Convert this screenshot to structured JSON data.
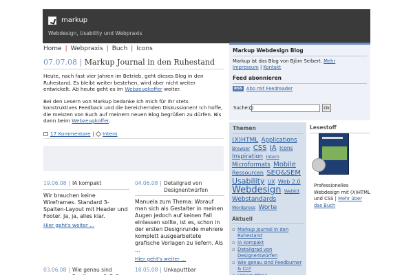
{
  "header": {
    "title": "markup",
    "tagline": "Webdesign, Usability und Webpraxis",
    "bg_color": "#3a3a3a"
  },
  "nav": {
    "items": [
      "Home",
      "Webpraxis",
      "Buch",
      "Icons"
    ]
  },
  "post": {
    "date": "07.07.08",
    "separator": "|",
    "title": "Markup Journal in den Ruhestand",
    "paragraph1": "Heute, nach fast vier Jahren im Betrieb, geht dieses Blog in den Ruhestand. Es bleibt weiter bestehen, wird aber nicht weiter entwickelt. Ab heute geht es im ",
    "paragraph1_link": "Webzeugkoffer",
    "paragraph1_end": " weiter.",
    "paragraph2": "Bei den Lesern von Markup bedanke ich mich für Ihr stets konstruktives Feedback und die bereichernden Diskussionen! Ich hoffe, die meisten von Euch auf meinem neuen Blog begrüßen zu dürfen. Bis dann beim ",
    "paragraph2_link": "Webzeugkoffer",
    "paragraph2_end": ".",
    "comments_link": "17 Kommentare",
    "meta_sep": "|",
    "category_link": "Intern"
  },
  "teasers": [
    {
      "date": "19.06.08",
      "title": "IA kompakt",
      "text": "Wir brauchen keine Wireframes. Standard 3-Spalten-Layout mit Header und Footer. Ja, ja, alles klar.",
      "more": "Hier geht's weiter ..."
    },
    {
      "date": "04.06.08",
      "title": "Detailgrad von Designentwürfen",
      "text": "Manuela zum Thema: Worauf man sich als Gestalter in meinen Augen jedoch auf keinen Fall einlassen sollte, ist es, schon in der ersten Designrunde mehrere komplett ausgearbeitete grafische Vorlagen zu liefern. Als ...",
      "more": "Hier geht's weiter ..."
    },
    {
      "date": "03.06.08",
      "title": "Wie genau sind Feedburner & Co?",
      "text": "",
      "more": ""
    },
    {
      "date": "18.05.08",
      "title": "Unkaputtbar",
      "text": "",
      "more": ""
    }
  ],
  "sidebar": {
    "blog_title": "Markup Webdesign Blog",
    "blog_desc": "Markup ist das Blog von Björn Seibert. ",
    "blog_more": "Mehr",
    "impressum": "Impressum",
    "link_sep": "|",
    "kontakt": "Kontakt",
    "feed_title": "Feed abonnieren",
    "rss_badge": "RSS",
    "rss_link": "Abo mit Feedreader",
    "search_label": "Suche:",
    "search_value": "",
    "search_button": "Ok"
  },
  "themen": {
    "title": "Themen",
    "tags": [
      {
        "label": "(X)HTML",
        "size": 9
      },
      {
        "label": "Applications",
        "size": 8.5
      },
      {
        "label": "Browser",
        "size": 6.5
      },
      {
        "label": "CSS",
        "size": 10
      },
      {
        "label": "IA",
        "size": 10
      },
      {
        "label": "Icons",
        "size": 7.5
      },
      {
        "label": "Inspiration",
        "size": 8.5
      },
      {
        "label": "Intern",
        "size": 6.5
      },
      {
        "label": "Microformats",
        "size": 8.5
      },
      {
        "label": "Mobile",
        "size": 10
      },
      {
        "label": "Ressourcen",
        "size": 8
      },
      {
        "label": "SEO&SEM",
        "size": 10
      },
      {
        "label": "Usability",
        "size": 11
      },
      {
        "label": "UX",
        "size": 7.5
      },
      {
        "label": "Web 2.0",
        "size": 8
      },
      {
        "label": "Webdesign",
        "size": 13
      },
      {
        "label": "Webkit",
        "size": 6.5
      },
      {
        "label": "Webstandards",
        "size": 9
      },
      {
        "label": "Wordpress",
        "size": 6.5
      },
      {
        "label": "Worte",
        "size": 9
      }
    ],
    "aktuell_title": "Aktuell",
    "aktuell": [
      "Markup Journal in den Ruhestand",
      "IA kompakt",
      "Detailgrad von Designentwürfen",
      "Wie genau sind Feedburner & Co?",
      "Unkaputtbar"
    ]
  },
  "lesestoff": {
    "title": "Lesestoff",
    "text_prefix": "Professionelles Webdesign mit (X)HTML und CSS | ",
    "link": "Mehr über das Buch"
  }
}
